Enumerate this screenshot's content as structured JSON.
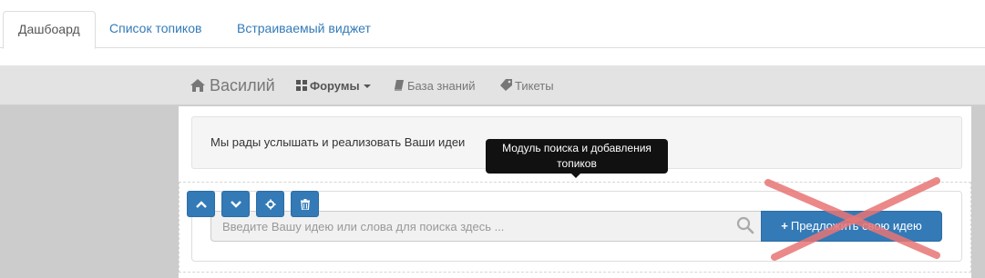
{
  "tabs": [
    {
      "label": "Дашбоард",
      "active": true
    },
    {
      "label": "Список топиков",
      "active": false
    },
    {
      "label": "Встраиваемый виджет",
      "active": false
    }
  ],
  "navbar": {
    "brand": "Василий",
    "items": {
      "forums": "Форумы",
      "knowledge": "База знаний",
      "tickets": "Тикеты"
    }
  },
  "welcome": {
    "text": "Мы рады услышать и реализовать Ваши идеи"
  },
  "tooltip": {
    "text": "Модуль поиска и добавления топиков"
  },
  "search": {
    "placeholder": "Введите Вашу идею или слова для поиска здесь ...",
    "value": ""
  },
  "suggest_button": {
    "plus": "+",
    "label": "Предложить свою идею"
  },
  "colors": {
    "accent": "#337ab7",
    "overlay_x": "#e87575"
  }
}
